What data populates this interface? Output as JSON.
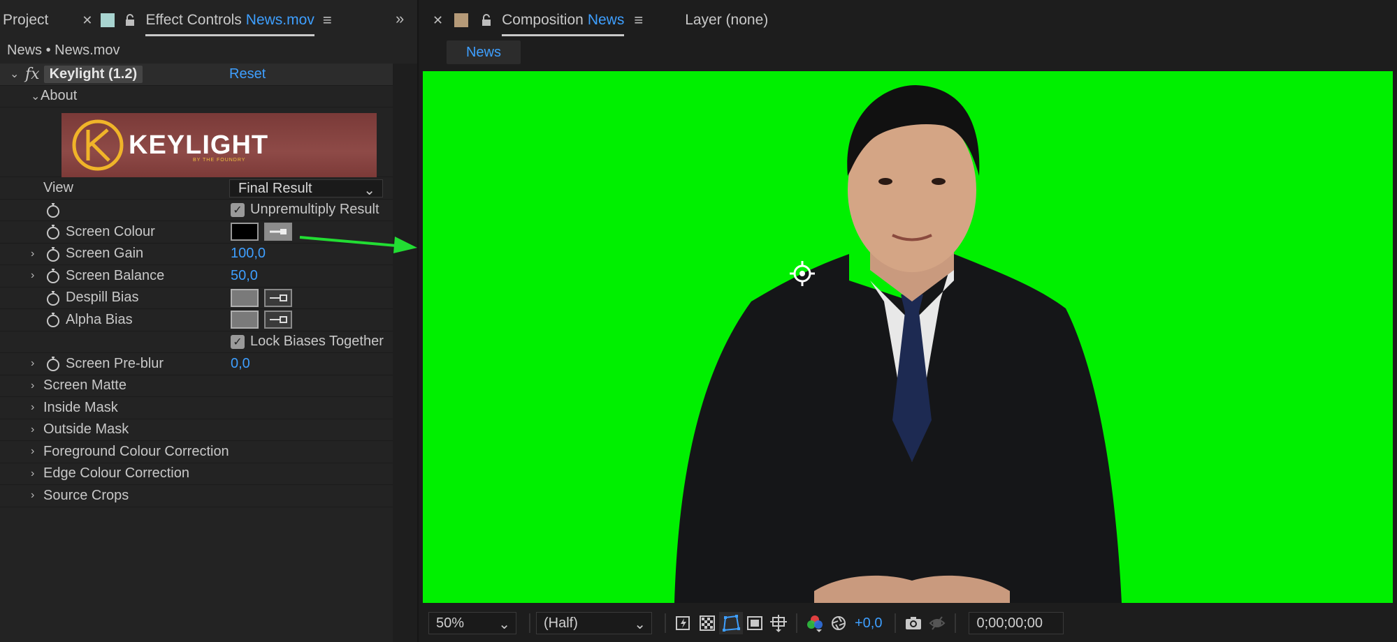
{
  "left_panel": {
    "tabs": [
      {
        "label": "Project"
      },
      {
        "label": "Effect Controls",
        "highlight": "News.mov"
      }
    ],
    "breadcrumb": "News • News.mov",
    "effect": {
      "name": "Keylight (1.2)",
      "reset_label": "Reset",
      "about_label": "About",
      "logo_text": "KEYLIGHT",
      "logo_sub": "BY THE FOUNDRY"
    },
    "params": {
      "view_label": "View",
      "view_value": "Final Result",
      "unpremultiply_label": "Unpremultiply Result",
      "screen_colour_label": "Screen Colour",
      "screen_gain_label": "Screen Gain",
      "screen_gain_value": "100,0",
      "screen_balance_label": "Screen Balance",
      "screen_balance_value": "50,0",
      "despill_bias_label": "Despill Bias",
      "alpha_bias_label": "Alpha Bias",
      "lock_biases_label": "Lock Biases Together",
      "screen_preblur_label": "Screen Pre-blur",
      "screen_preblur_value": "0,0",
      "groups": [
        "Screen Matte",
        "Inside Mask",
        "Outside Mask",
        "Foreground Colour Correction",
        "Edge Colour Correction",
        "Source Crops"
      ]
    }
  },
  "right_panel": {
    "tabs": [
      {
        "label": "Composition",
        "highlight": "News"
      },
      {
        "label": "Layer (none)"
      }
    ],
    "sub_tab": "News",
    "bottom": {
      "zoom": "50%",
      "resolution": "(Half)",
      "exposure": "+0,0",
      "timecode": "0;00;00;00"
    }
  },
  "colors": {
    "accent_blue": "#3e9fff",
    "green_screen": "#00f000",
    "panel_bg": "#232323",
    "arrow_green": "#22dd33"
  }
}
